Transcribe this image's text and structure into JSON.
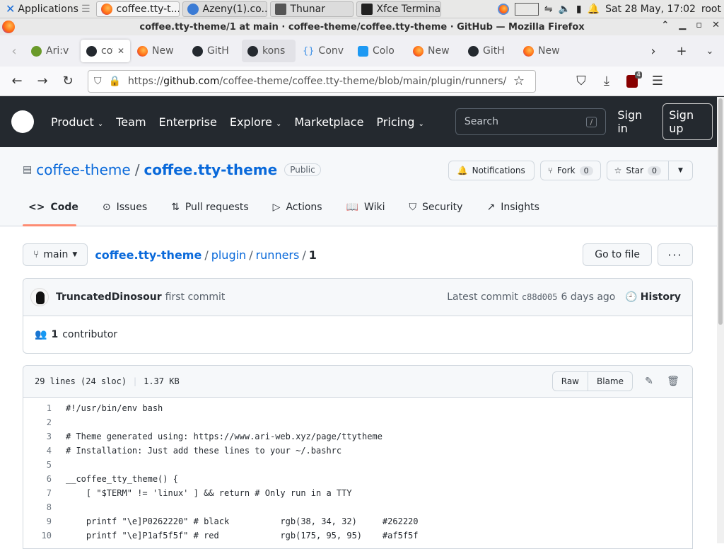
{
  "taskbar": {
    "applications": "Applications",
    "windows": [
      {
        "label": "coffee.tty-t...",
        "active": true
      },
      {
        "label": "Azeny(1).co...",
        "active": false
      },
      {
        "label": "Thunar",
        "active": false
      },
      {
        "label": "Xfce Terminal",
        "active": false
      }
    ],
    "clock": "Sat 28 May, 17:02",
    "user": "root"
  },
  "window": {
    "title": "coffee.tty-theme/1 at main · coffee-theme/coffee.tty-theme · GitHub — Mozilla Firefox"
  },
  "tabs": [
    {
      "label": "Ari:v",
      "icon": "leaf-icon"
    },
    {
      "label": "cof",
      "icon": "github-icon",
      "selected": true
    },
    {
      "label": "New",
      "icon": "firefox-icon"
    },
    {
      "label": "GitH",
      "icon": "github-icon"
    },
    {
      "label": "kons",
      "icon": "github-icon",
      "hover": true
    },
    {
      "label": "Conv",
      "icon": "braces-icon"
    },
    {
      "label": "Colo",
      "icon": "k-icon"
    },
    {
      "label": "New",
      "icon": "firefox-icon"
    },
    {
      "label": "GitH",
      "icon": "github-icon"
    },
    {
      "label": "New",
      "icon": "firefox-icon"
    }
  ],
  "navbar": {
    "url_prefix": "https://",
    "url_domain": "github.com",
    "url_path": "/coffee-theme/coffee.tty-theme/blob/main/plugin/runners/",
    "ext_badge": "4"
  },
  "gh_header": {
    "nav": [
      "Product",
      "Team",
      "Enterprise",
      "Explore",
      "Marketplace",
      "Pricing"
    ],
    "search_placeholder": "Search",
    "slash": "/",
    "sign_in": "Sign in",
    "sign_up": "Sign up"
  },
  "repo": {
    "owner": "coffee-theme",
    "sep": "/",
    "name": "coffee.tty-theme",
    "visibility": "Public",
    "notifications": "Notifications",
    "fork": "Fork",
    "fork_count": "0",
    "star": "Star",
    "star_count": "0",
    "tabs": [
      "Code",
      "Issues",
      "Pull requests",
      "Actions",
      "Wiki",
      "Security",
      "Insights"
    ]
  },
  "filenav": {
    "branch": "main",
    "crumbs": [
      "coffee.tty-theme",
      "plugin",
      "runners"
    ],
    "current": "1",
    "goto": "Go to file",
    "more": "···"
  },
  "commit": {
    "author": "TruncatedDinosour",
    "message": "first commit",
    "latest_label": "Latest commit",
    "sha": "c88d005",
    "age": "6 days ago",
    "history": "History",
    "contributors_count": "1",
    "contributors_label": "contributor"
  },
  "file": {
    "lines_info": "29 lines (24 sloc)",
    "size": "1.37 KB",
    "raw": "Raw",
    "blame": "Blame",
    "code": [
      {
        "n": "1",
        "t": "#!/usr/bin/env bash"
      },
      {
        "n": "2",
        "t": ""
      },
      {
        "n": "3",
        "t": "# Theme generated using: https://www.ari-web.xyz/page/ttytheme"
      },
      {
        "n": "4",
        "t": "# Installation: Just add these lines to your ~/.bashrc"
      },
      {
        "n": "5",
        "t": ""
      },
      {
        "n": "6",
        "t": "__coffee_tty_theme() {"
      },
      {
        "n": "7",
        "t": "    [ \"$TERM\" != 'linux' ] && return # Only run in a TTY"
      },
      {
        "n": "8",
        "t": ""
      },
      {
        "n": "9",
        "t": "    printf \"\\e]P0262220\" # black          rgb(38, 34, 32)     #262220"
      },
      {
        "n": "10",
        "t": "    printf \"\\e]P1af5f5f\" # red            rgb(175, 95, 95)    #af5f5f"
      }
    ]
  },
  "colors": {
    "gh_dark": "#24292f",
    "link": "#0969da",
    "tab_underline": "#fd8c73"
  }
}
